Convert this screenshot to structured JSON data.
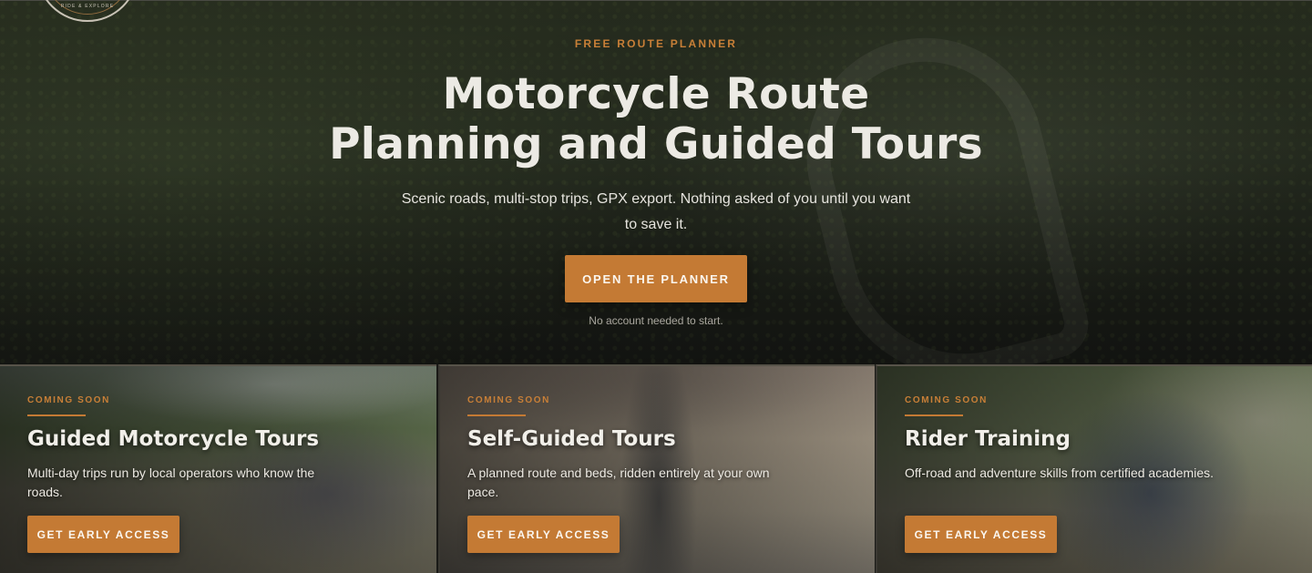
{
  "logo": {
    "text": "RIDE & EXPLORE"
  },
  "hero": {
    "eyebrow": "FREE ROUTE PLANNER",
    "title_line1": "Motorcycle Route",
    "title_line2": "Planning and Guided Tours",
    "subtitle": "Scenic roads, multi-stop trips, GPX export. Nothing asked of you until you want to save it.",
    "cta_label": "OPEN THE PLANNER",
    "note": "No account needed to start."
  },
  "cards": [
    {
      "eyebrow": "COMING SOON",
      "title": "Guided Motorcycle Tours",
      "description": "Multi-day trips run by local operators who know the roads.",
      "button_label": "GET EARLY ACCESS"
    },
    {
      "eyebrow": "COMING SOON",
      "title": "Self-Guided Tours",
      "description": "A planned route and beds, ridden entirely at your own pace.",
      "button_label": "GET EARLY ACCESS"
    },
    {
      "eyebrow": "COMING SOON",
      "title": "Rider Training",
      "description": "Off-road and adventure skills from certified academies.",
      "button_label": "GET EARLY ACCESS"
    }
  ],
  "colors": {
    "accent": "#c47a34",
    "eyebrow": "#c87f37",
    "text": "#eceae4"
  }
}
